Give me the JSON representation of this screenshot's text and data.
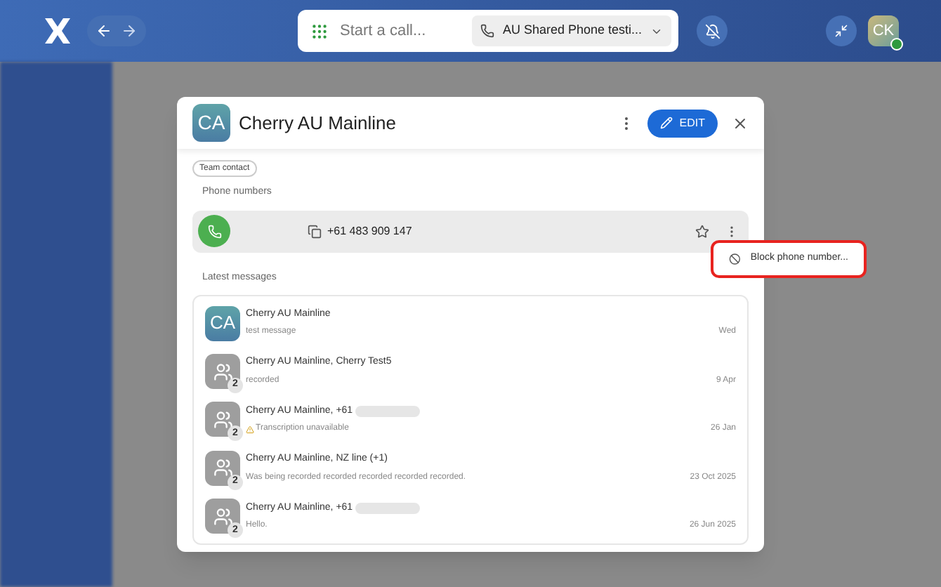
{
  "topbar": {
    "search": {
      "placeholder": "Start a call..."
    },
    "line_selector": "AU Shared Phone testi..."
  },
  "user": {
    "initials": "CK",
    "online": true
  },
  "contact": {
    "initials": "CA",
    "name": "Cherry AU Mainline",
    "edit_label": "EDIT",
    "tag": "Team contact",
    "phone_section": "Phone numbers",
    "phone": "+61 483 909 147",
    "favorite": false,
    "messages_section": "Latest messages"
  },
  "menu": {
    "items": [
      {
        "label": "Block phone number...",
        "highlighted": true
      }
    ]
  },
  "messages": [
    {
      "kind": "initials",
      "initials": "CA",
      "title": "Cherry AU Mainline",
      "redacted": false,
      "preview": "test message",
      "warning": false,
      "date": "Wed"
    },
    {
      "kind": "group",
      "count": "2",
      "title": "Cherry AU Mainline, Cherry Test5",
      "redacted": false,
      "preview": "recorded",
      "warning": false,
      "date": "9 Apr"
    },
    {
      "kind": "group",
      "count": "2",
      "title": "Cherry AU Mainline, +61",
      "redacted": true,
      "preview": "Transcription unavailable",
      "warning": true,
      "date": "26 Jan"
    },
    {
      "kind": "group",
      "count": "2",
      "title": "Cherry AU Mainline, NZ line (+1)",
      "redacted": false,
      "preview": "Was being recorded recorded recorded recorded recorded.",
      "warning": false,
      "date": "23 Oct 2025"
    },
    {
      "kind": "group",
      "count": "2",
      "title": "Cherry AU Mainline, +61",
      "redacted": true,
      "preview": "Hello.",
      "warning": false,
      "date": "26 Jun 2025"
    }
  ]
}
